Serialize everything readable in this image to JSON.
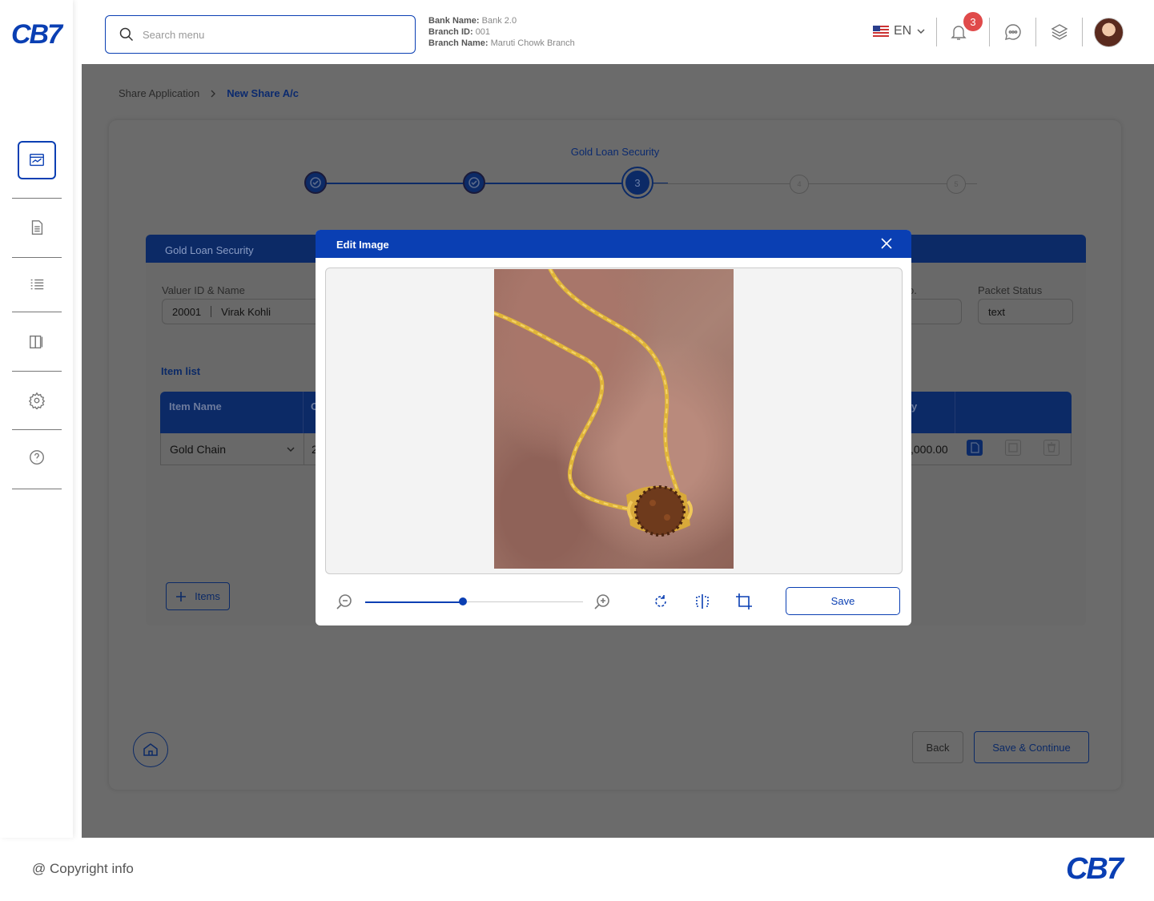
{
  "brand": {
    "logo_text": "CB7",
    "accent": "#0a3fb3"
  },
  "header": {
    "search_placeholder": "Search menu",
    "bank_name_label": "Bank Name:",
    "bank_name_value": "Bank 2.0",
    "branch_id_label": "Branch ID:",
    "branch_id_value": "001",
    "branch_name_label": "Branch Name:",
    "branch_name_value": "Maruti Chowk Branch",
    "language": "EN",
    "notification_count": "3"
  },
  "breadcrumb": {
    "parent": "Share Application",
    "current": "New Share A/c"
  },
  "stepper": {
    "current_title": "Gold Loan Security",
    "steps": [
      "",
      "",
      "3",
      "4",
      "5"
    ],
    "current_step": 3
  },
  "section": {
    "title": "Gold Loan Security",
    "valuer_label": "Valuer ID & Name",
    "valuer_id": "20001",
    "valuer_name": "Virak Kohli",
    "no_label_fragment": "o.",
    "packet_status_label": "Packet Status",
    "packet_status_value": "text",
    "item_list_label": "Item list",
    "table_headers": {
      "item_name": "Item Name",
      "col2_fragment": "C",
      "col_right_fragment": "y"
    },
    "row": {
      "item_name": "Gold Chain",
      "col2_fragment": "2",
      "amount_fragment": ",000.00"
    },
    "add_items_label": "Items"
  },
  "footer_actions": {
    "back": "Back",
    "save_continue": "Save & Continue"
  },
  "modal": {
    "title": "Edit Image",
    "save_label": "Save",
    "zoom_level": 0.45
  },
  "footer": {
    "copyright": "@ Copyright info"
  }
}
